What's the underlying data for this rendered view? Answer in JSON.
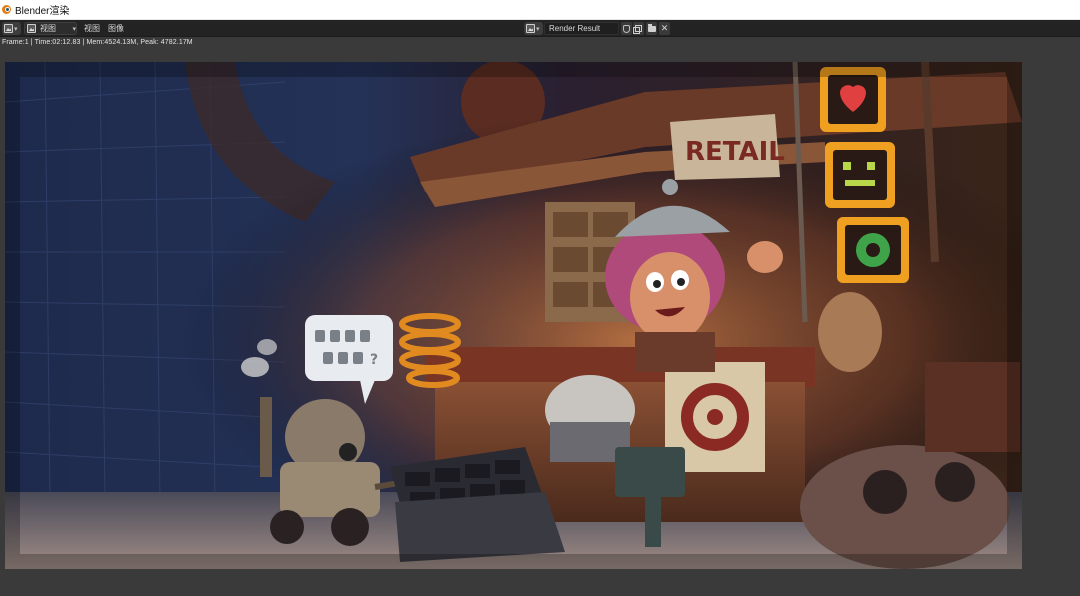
{
  "window": {
    "title": "Blender渲染"
  },
  "header": {
    "view_dropdown": "视图",
    "menus": {
      "view": "视图",
      "image": "图像"
    },
    "image_name": "Render Result",
    "image_type_icon": "image-icon",
    "buttons": [
      "fake-user-shield-icon",
      "new-image-icon",
      "open-folder-icon",
      "unlink-x-icon"
    ],
    "close_glyph": "✕"
  },
  "stats": {
    "text": "Frame:1 | Time:02:12.83 | Mem:4524.13M, Peak: 4782.17M"
  },
  "render": {
    "description_icons": [
      "robot",
      "speech-bubble",
      "shop-counter",
      "character",
      "retail-sign",
      "led-signs"
    ],
    "sign_text": "RETAIL",
    "colors": {
      "bg_blue": "#1b2746",
      "warm_light": "#d88848",
      "led_orange": "#f0a020"
    }
  }
}
